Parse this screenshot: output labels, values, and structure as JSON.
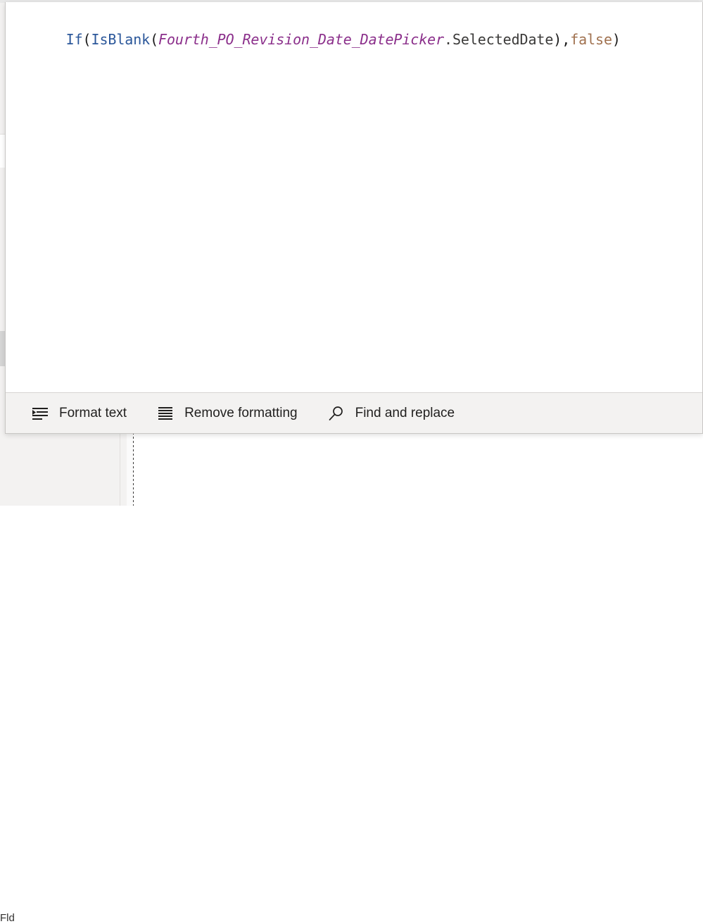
{
  "formula_editor": {
    "formula_tokens": [
      {
        "text": "If",
        "kind": "function"
      },
      {
        "text": "(",
        "kind": "punct"
      },
      {
        "text": "IsBlank",
        "kind": "function"
      },
      {
        "text": "(",
        "kind": "punct"
      },
      {
        "text": "Fourth_PO_Revision_Date_DatePicker",
        "kind": "identifier"
      },
      {
        "text": ".SelectedDate",
        "kind": "property"
      },
      {
        "text": ")",
        "kind": "punct"
      },
      {
        "text": ",",
        "kind": "punct"
      },
      {
        "text": "false",
        "kind": "boolean"
      },
      {
        "text": ")",
        "kind": "punct"
      }
    ],
    "formula_full_text": "If(IsBlank(Fourth_PO_Revision_Date_DatePicker.SelectedDate),false)",
    "command_bar": {
      "format_text_label": "Format text",
      "format_text_icon": "format-text-icon",
      "remove_formatting_label": "Remove formatting",
      "remove_formatting_icon": "remove-formatting-icon",
      "find_and_replace_label": "Find and replace",
      "find_and_replace_icon": "search-icon"
    }
  },
  "canvas": {
    "left_panel_label": "Fld",
    "selected_control": {
      "name": "selected-control",
      "fill_color": "#bac9e3",
      "border_color": "#8e2f8e",
      "handle_count": 8
    }
  },
  "colors": {
    "function_token": "#2b579a",
    "identifier_token": "#8b2f8b",
    "property_token": "#3b3a39",
    "boolean_token": "#a0714f",
    "punct_token": "#1b1b1b",
    "command_bar_bg": "#f3f2f1",
    "selection_border": "#8e2f8e",
    "selection_fill": "#bac9e3"
  }
}
